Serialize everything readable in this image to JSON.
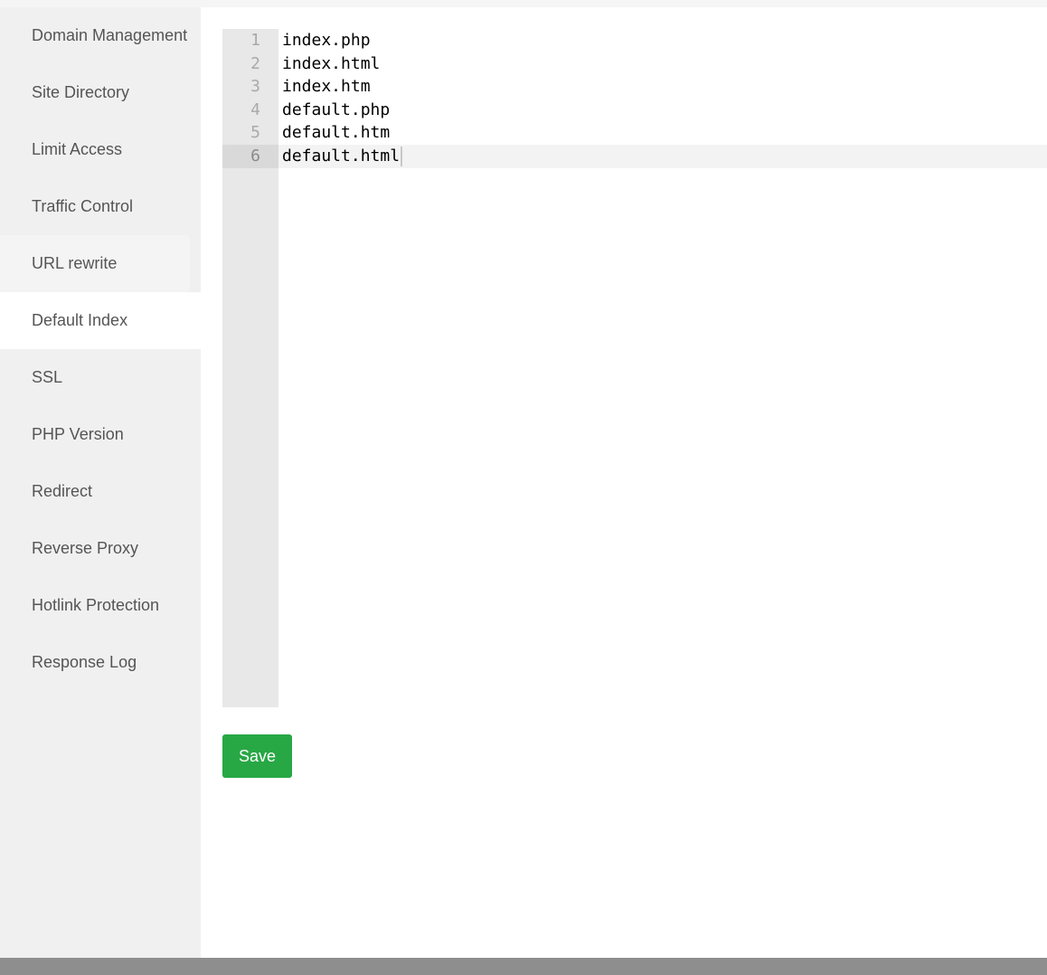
{
  "sidebar": {
    "items": [
      {
        "label": "Domain Management"
      },
      {
        "label": "Site Directory"
      },
      {
        "label": "Limit Access"
      },
      {
        "label": "Traffic Control"
      },
      {
        "label": "URL rewrite"
      },
      {
        "label": "Default Index"
      },
      {
        "label": "SSL"
      },
      {
        "label": "PHP Version"
      },
      {
        "label": "Redirect"
      },
      {
        "label": "Reverse Proxy"
      },
      {
        "label": "Hotlink Protection"
      },
      {
        "label": "Response Log"
      }
    ],
    "active_item": "Default Index",
    "hovered_item": "URL rewrite"
  },
  "editor": {
    "lines": [
      {
        "num": "1",
        "text": "index.php"
      },
      {
        "num": "2",
        "text": "index.html"
      },
      {
        "num": "3",
        "text": "index.htm"
      },
      {
        "num": "4",
        "text": "default.php"
      },
      {
        "num": "5",
        "text": "default.htm"
      },
      {
        "num": "6",
        "text": "default.html"
      }
    ],
    "current_line": "6"
  },
  "actions": {
    "save_label": "Save"
  },
  "colors": {
    "accent": "#28a745",
    "sidebar_bg": "#f0f0f0",
    "gutter_bg": "#e8e8e8"
  }
}
